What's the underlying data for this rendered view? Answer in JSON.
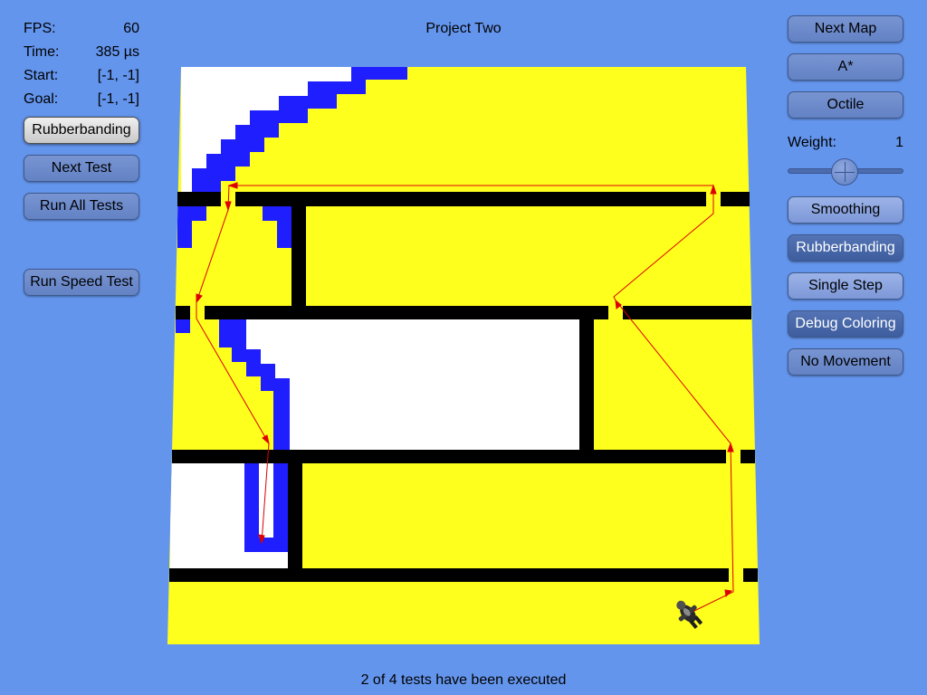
{
  "title": "Project Two",
  "stats": {
    "fps_label": "FPS:",
    "fps_value": "60",
    "time_label": "Time:",
    "time_value": "385 µs",
    "start_label": "Start:",
    "start_value": "[-1, -1]",
    "goal_label": "Goal:",
    "goal_value": "[-1, -1]"
  },
  "left_buttons": {
    "rubberbanding": "Rubberbanding",
    "next_test": "Next Test",
    "run_all_tests": "Run All Tests",
    "run_speed_test": "Run Speed Test"
  },
  "right_buttons": {
    "next_map": "Next Map",
    "algorithm": "A*",
    "heuristic": "Octile",
    "smoothing": "Smoothing",
    "rubberbanding": "Rubberbanding",
    "single_step": "Single Step",
    "debug_coloring": "Debug Coloring",
    "no_movement": "No Movement"
  },
  "weight": {
    "label": "Weight:",
    "value": "1",
    "level": 0.5
  },
  "footer": "2 of 4 tests have been executed",
  "colors": {
    "background": "#6495ed",
    "open": "#ffff1e",
    "wall": "#000000",
    "unexplored": "#ffffff",
    "closed_list": "#1e1eff",
    "path": "#dc0000"
  },
  "icons": {
    "agent": "agent-sprite-icon"
  }
}
